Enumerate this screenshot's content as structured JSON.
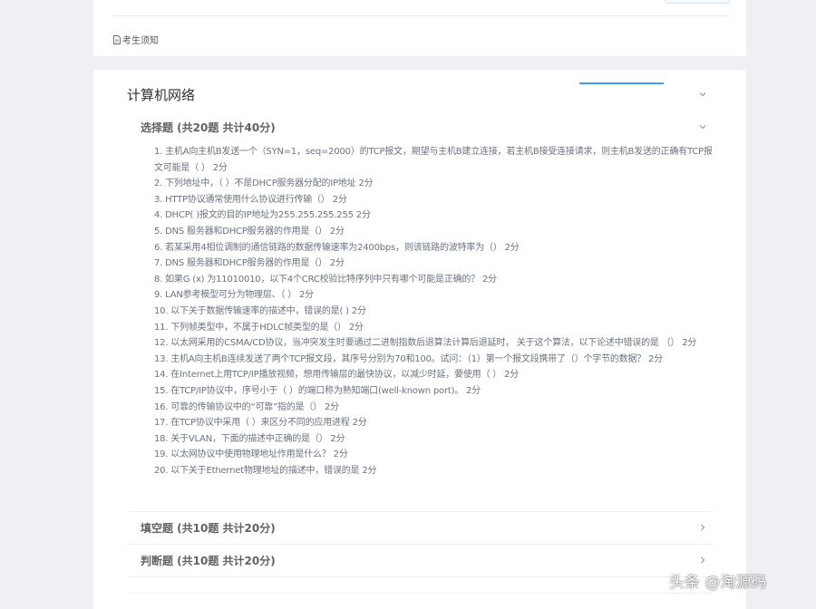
{
  "notice": {
    "label": "考生须知"
  },
  "subject": {
    "title": "计算机网络"
  },
  "sections": [
    {
      "label": "选择题 (共20题 共计40分)",
      "expanded": true
    },
    {
      "label": "填空题 (共10题 共计20分)",
      "expanded": false
    },
    {
      "label": "判断题 (共10题 共计20分)",
      "expanded": false
    }
  ],
  "questions": [
    "1. 主机A向主机B发送一个（SYN=1，seq=2000）的TCP报文，期望与主机B建立连接，若主机B接受连接请求，则主机B发送的正确有TCP报文可能是（ ） 2分",
    "2. 下列地址中，（ ）不是DHCP服务器分配的IP地址 2分",
    "3. HTTP协议通常使用什么协议进行传输（） 2分",
    "4. DHCP( )报文的目的IP地址为255.255.255.255 2分",
    "5. DNS 服务器和DHCP服务器的作用是（） 2分",
    "6. 若某采用4相位调制的通信链路的数据传输速率为2400bps，则该链路的波特率为（） 2分",
    "7. DNS 服务器和DHCP服务器的作用是（） 2分",
    "8. 如果G (x) 为11010010，以下4个CRC校验比特序列中只有哪个可能是正确的？ 2分",
    "9. LAN参考模型可分为物理层、（ ） 2分",
    "10. 以下关于数据传输速率的描述中，错误的是( ) 2分",
    "11. 下列帧类型中，不属于HDLC帧类型的是（） 2分",
    "12. 以太网采用的CSMA/CD协议，当冲突发生时要通过二进制指数后退算法计算后退延时， 关于这个算法，以下论述中错误的是 （） 2分",
    "13. 主机A向主机B连续发送了两个TCP报文段，其序号分别为70和100。试问：（1）第一个报文段携带了（）个字节的数据？ 2分",
    "14. 在Internet上用TCP/IP播放视频，想用传输层的最快协议，以减少时延，要使用（ ） 2分",
    "15. 在TCP/IP协议中，序号小于（ ）的端口称为熟知端口(well-known port)。 2分",
    "16. 可靠的传输协议中的“可靠”指的是（） 2分",
    "17. 在TCP协议中采用（ ）来区分不同的应用进程 2分",
    "18. 关于VLAN，下面的描述中正确的是（） 2分",
    "19. 以太网协议中使用物理地址作用是什么？ 2分",
    "20. 以下关于Ethernet物理地址的描述中，错误的是 2分"
  ],
  "watermark": "头条 @淘源码",
  "icons": {
    "notice": "document-icon",
    "collapse": "chevron-down-icon",
    "expand": "chevron-right-icon"
  },
  "colors": {
    "accent": "#409eff",
    "background": "#eef0f3",
    "card": "#ffffff",
    "text": "#606266"
  }
}
